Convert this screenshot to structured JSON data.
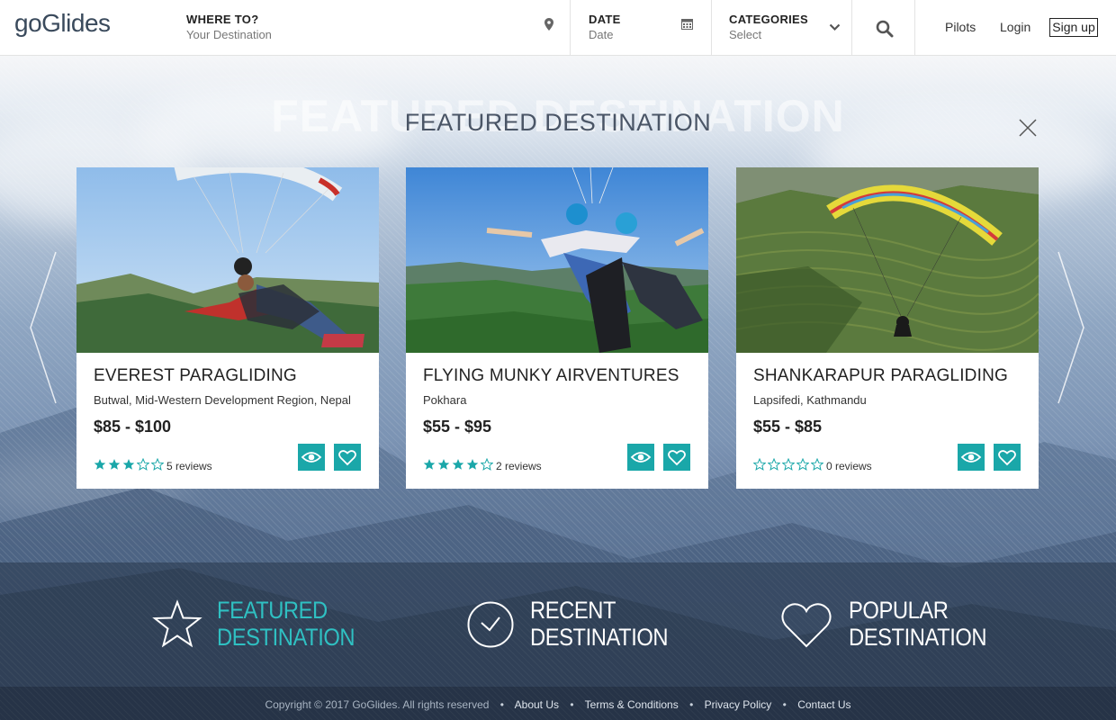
{
  "header": {
    "logo": "goGlides",
    "where_label": "WHERE TO?",
    "where_value": "Your Destination",
    "date_label": "DATE",
    "date_value": "Date",
    "categories_label": "CATEGORIES",
    "categories_value": "Select",
    "nav": {
      "pilots": "Pilots",
      "login": "Login",
      "signup": "Sign up"
    }
  },
  "section": {
    "ghost_title": "FEATURED DESTINATION",
    "title": "FEATURED DESTINATION"
  },
  "cards": [
    {
      "title": "EVEREST PARAGLIDING",
      "location": "Butwal, Mid-Western Development Region, Nepal",
      "price": "$85 - $100",
      "rating": 3,
      "reviews": "5 reviews"
    },
    {
      "title": "FLYING MUNKY AIRVENTURES",
      "location": "Pokhara",
      "price": "$55 - $95",
      "rating": 4,
      "reviews": "2 reviews"
    },
    {
      "title": "SHANKARAPUR PARAGLIDING",
      "location": "Lapsifedi, Kathmandu",
      "price": "$55 - $85",
      "rating": 0,
      "reviews": "0 reviews"
    }
  ],
  "band": [
    {
      "line1": "FEATURED",
      "line2": "DESTINATION",
      "icon": "star-icon",
      "active": true
    },
    {
      "line1": "RECENT",
      "line2": "DESTINATION",
      "icon": "check-circle-icon",
      "active": false
    },
    {
      "line1": "POPULAR",
      "line2": "DESTINATION",
      "icon": "heart-icon",
      "active": false
    }
  ],
  "footer": {
    "copyright": "Copyright © 2017 GoGlides. All rights reserved",
    "about": "About Us",
    "terms": "Terms & Conditions",
    "privacy": "Privacy Policy",
    "contact": "Contact Us"
  },
  "colors": {
    "accent": "#1aa7a9",
    "accent_text": "#2fc0c2"
  }
}
